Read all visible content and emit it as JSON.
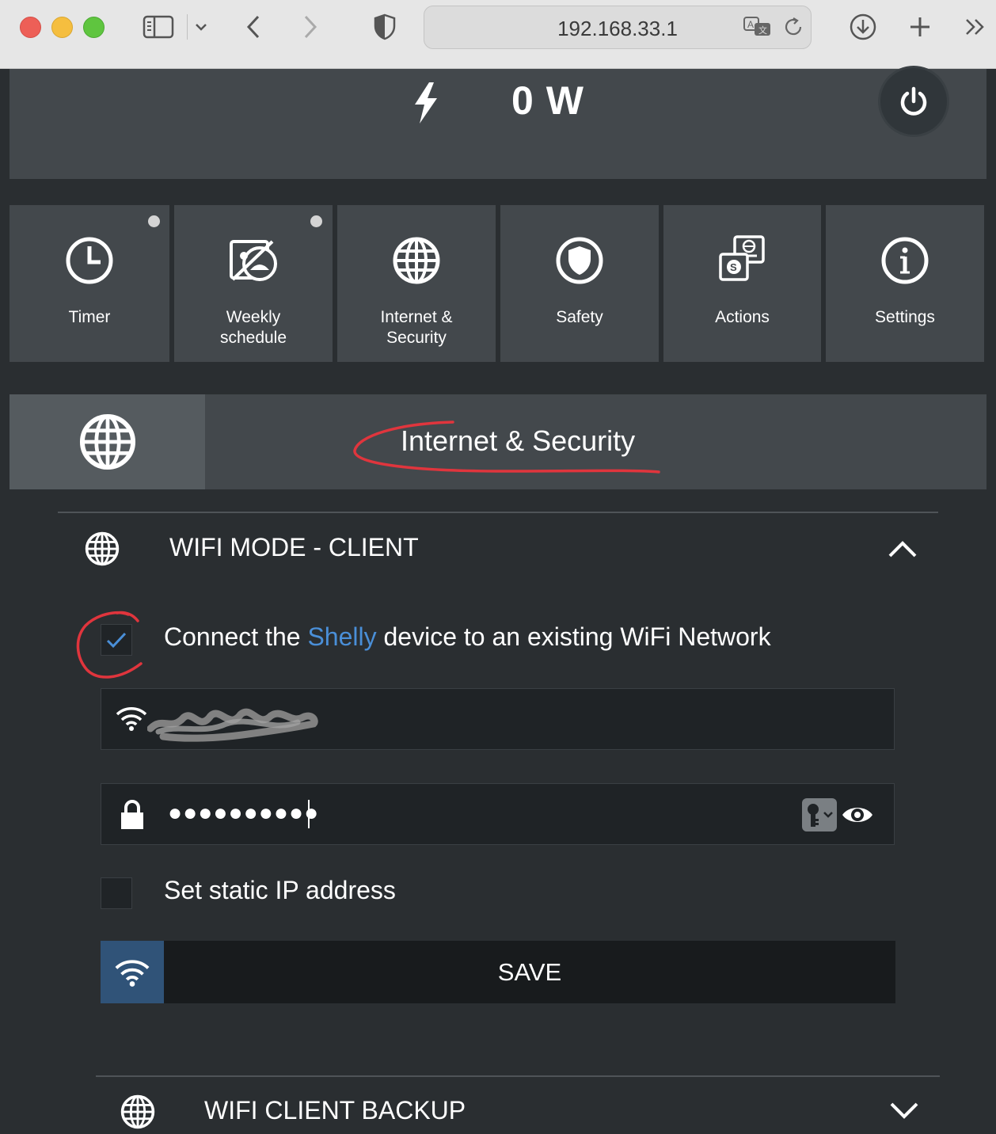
{
  "browser": {
    "url": "192.168.33.1"
  },
  "header": {
    "power_value": "0 W"
  },
  "tiles": [
    {
      "label": "Timer"
    },
    {
      "label": "Weekly\nschedule"
    },
    {
      "label": "Internet &\nSecurity"
    },
    {
      "label": "Safety"
    },
    {
      "label": "Actions"
    },
    {
      "label": "Settings"
    }
  ],
  "section": {
    "title": "Internet & Security"
  },
  "wifi_client": {
    "title": "WIFI MODE - CLIENT",
    "connect_prefix": "Connect the ",
    "connect_brand": "Shelly",
    "connect_suffix": " device to an existing WiFi Network",
    "connect_checked": true,
    "password_masked": "●●●●●●●●●●",
    "static_ip_label": "Set static IP address",
    "save_label": "SAVE"
  },
  "wifi_backup": {
    "title": "WIFI CLIENT BACKUP"
  },
  "colors": {
    "accent_blue": "#4a8fd8",
    "annotation_red": "#e0353d",
    "save_icon_bg": "#305378"
  }
}
